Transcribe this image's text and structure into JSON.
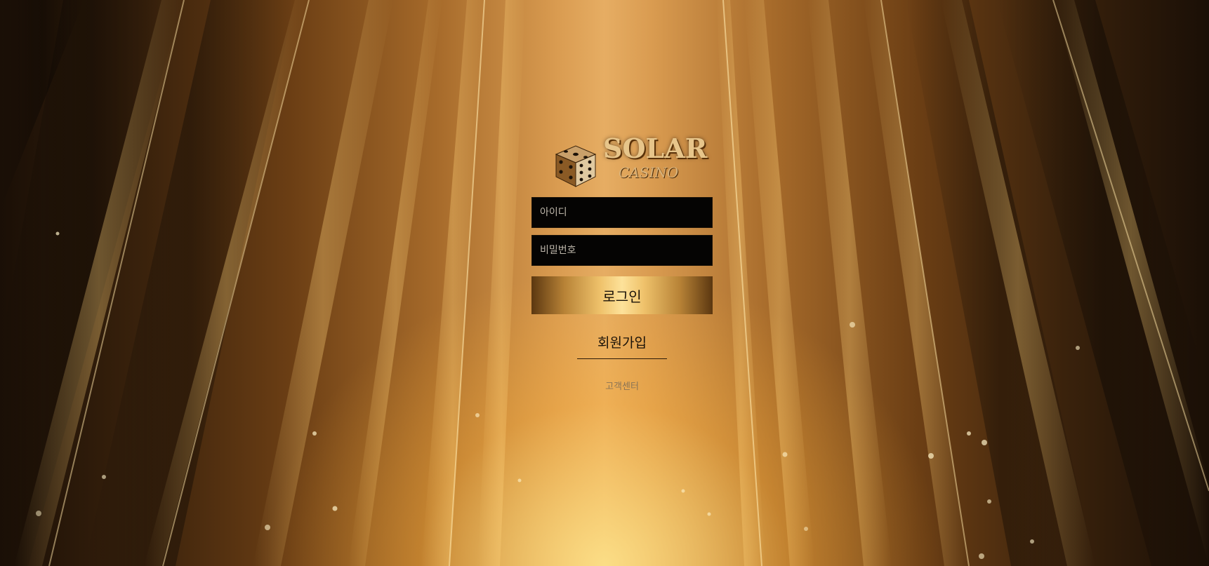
{
  "brand": {
    "logo_icon": "dice-icon",
    "name": "SOLAR",
    "subtitle": "CASINO",
    "colors": {
      "gold": "#e7c58a",
      "gold_dark": "#5a3209",
      "input_bg": "#050403"
    }
  },
  "login": {
    "id_placeholder": "아이디",
    "password_placeholder": "비밀번호",
    "submit_label": "로그인",
    "signup_label": "회원가입",
    "support_label": "고객센터"
  }
}
